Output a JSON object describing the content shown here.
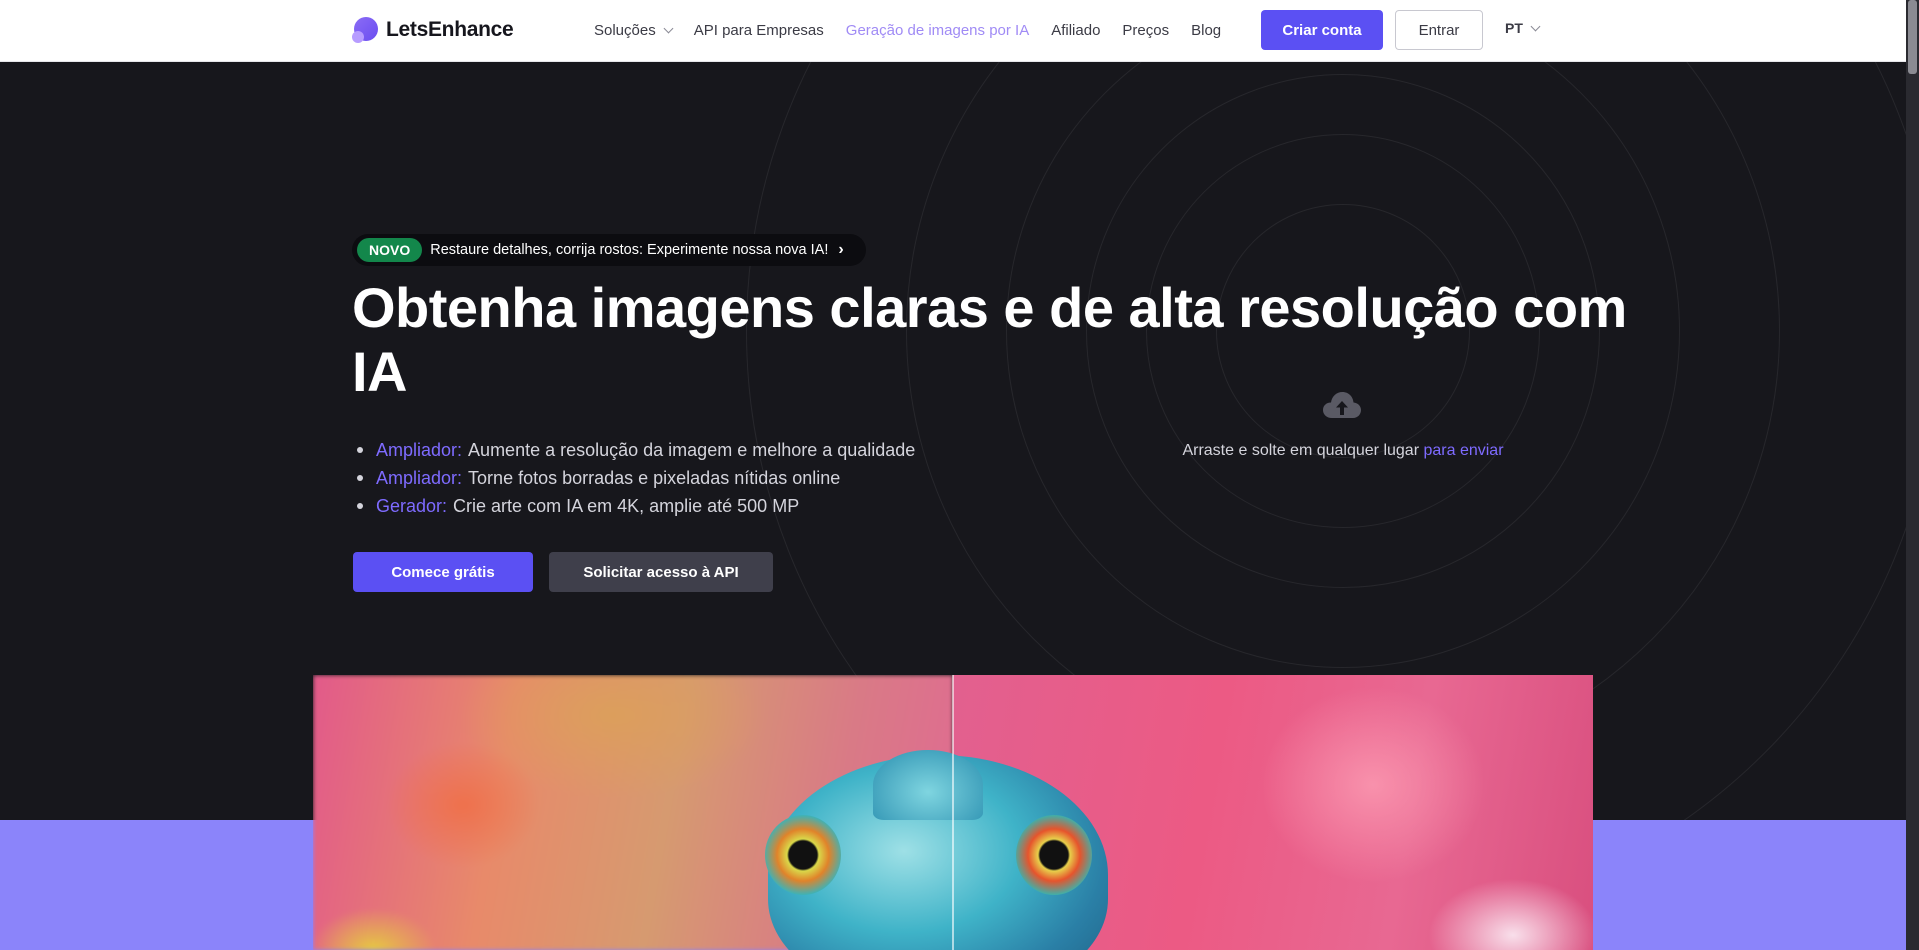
{
  "header": {
    "logo_text": "LetsEnhance",
    "nav": [
      {
        "label": "Soluções",
        "has_dropdown": true
      },
      {
        "label": "API para Empresas"
      },
      {
        "label": "Geração de imagens por IA",
        "active": true
      },
      {
        "label": "Afiliado"
      },
      {
        "label": "Preços"
      },
      {
        "label": "Blog"
      }
    ],
    "signup_label": "Criar conta",
    "login_label": "Entrar",
    "language": "PT"
  },
  "hero": {
    "badge_new": "NOVO",
    "badge_text": "Restaure detalhes, corrija rostos: Experimente nossa nova IA!",
    "badge_arrow": "›",
    "title": "Obtenha imagens claras e de alta resolução com IA",
    "features": [
      {
        "key": "Ampliador:",
        "text": "Aumente a resolução da imagem e melhore a qualidade"
      },
      {
        "key": "Ampliador:",
        "text": "Torne fotos borradas e pixeladas nítidas online"
      },
      {
        "key": "Gerador:",
        "text": "Crie arte com IA em 4K, amplie até 500 MP"
      }
    ],
    "cta_primary": "Comece grátis",
    "cta_secondary": "Solicitar acesso à API"
  },
  "upload": {
    "icon": "cloud-upload-icon",
    "text": "Arraste e solte em qualquer lugar",
    "link": "para enviar"
  },
  "colors": {
    "accent": "#5b50f3",
    "accent_text": "#7e6bff",
    "hero_bg": "#17171c",
    "band": "#8b84fa",
    "badge_green": "#13874b"
  }
}
